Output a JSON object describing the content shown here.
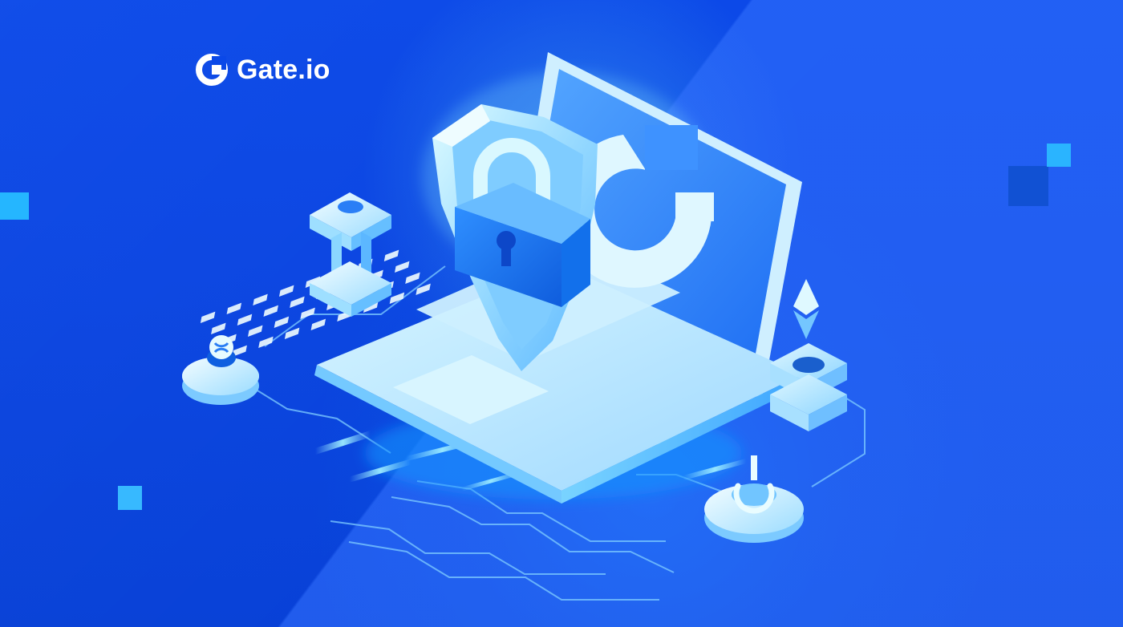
{
  "brand": {
    "name": "Gate.io"
  },
  "colors": {
    "background": "#0a48e8",
    "accent_light": "#cdefff",
    "accent_mid": "#6ec8ff",
    "accent_blue": "#1d8fff",
    "accent_square": "#25b6ff"
  },
  "icons": {
    "logo": "gate-logo-icon",
    "shield": "shield-icon",
    "lock": "padlock-icon",
    "ethereum": "ethereum-icon",
    "coin": "xrp-coin-icon",
    "power": "power-node-icon"
  }
}
